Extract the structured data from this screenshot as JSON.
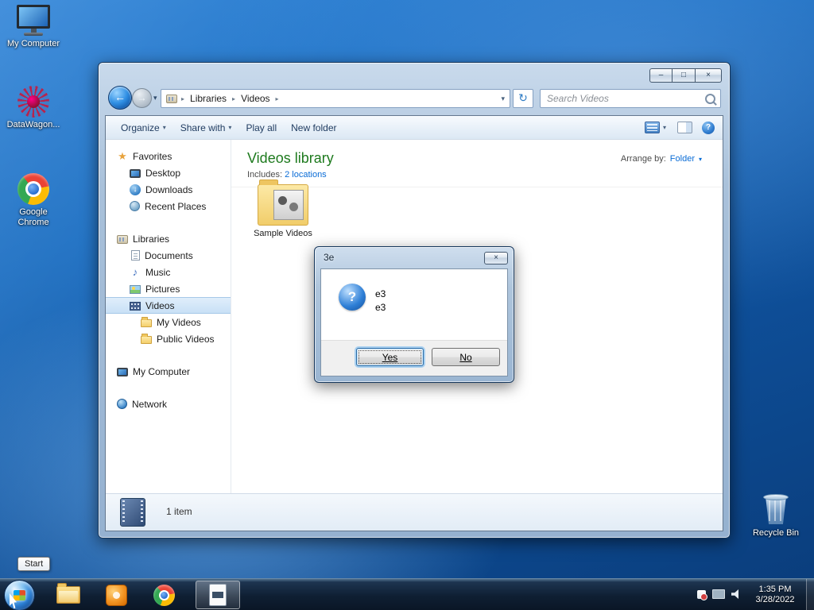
{
  "desktop": {
    "icons": {
      "my_computer": "My Computer",
      "datawagon": "DataWagon...",
      "chrome_line1": "Google",
      "chrome_line2": "Chrome",
      "recycle_bin": "Recycle Bin"
    },
    "start_tooltip": "Start"
  },
  "explorer": {
    "nav": {
      "breadcrumb": {
        "root": "Libraries",
        "current": "Videos"
      },
      "search_placeholder": "Search Videos"
    },
    "toolbar": {
      "organize": "Organize",
      "share_with": "Share with",
      "play_all": "Play all",
      "new_folder": "New folder"
    },
    "sidebar": {
      "favorites": "Favorites",
      "desktop": "Desktop",
      "downloads": "Downloads",
      "recent_places": "Recent Places",
      "libraries": "Libraries",
      "documents": "Documents",
      "music": "Music",
      "pictures": "Pictures",
      "videos": "Videos",
      "my_videos": "My Videos",
      "public_videos": "Public Videos",
      "my_computer": "My Computer",
      "network": "Network"
    },
    "content": {
      "title": "Videos library",
      "includes_label": "Includes:",
      "includes_link": "2 locations",
      "arrange_label": "Arrange by:",
      "arrange_value": "Folder",
      "folder_label": "Sample Videos"
    },
    "status": {
      "item_count": "1 item"
    }
  },
  "dialog": {
    "title": "3e",
    "line1": "e3",
    "line2": "e3",
    "yes_label": "Yes",
    "no_label": "No"
  },
  "taskbar": {
    "clock_time": "1:35 PM",
    "clock_date": "3/28/2022"
  },
  "icons": {
    "back": "←",
    "forward": "→",
    "dropdown": "▾",
    "crumb_sep": "▸",
    "refresh": "↻",
    "minimize": "–",
    "maximize": "□",
    "close": "×",
    "help": "?",
    "question": "?",
    "star": "★",
    "music_note": "♪",
    "down_arrow": "↓"
  },
  "colors": {
    "library_title_green": "#1e7a1e",
    "link_blue": "#0a6cd6",
    "selection_blue": "#c8e0f6"
  }
}
